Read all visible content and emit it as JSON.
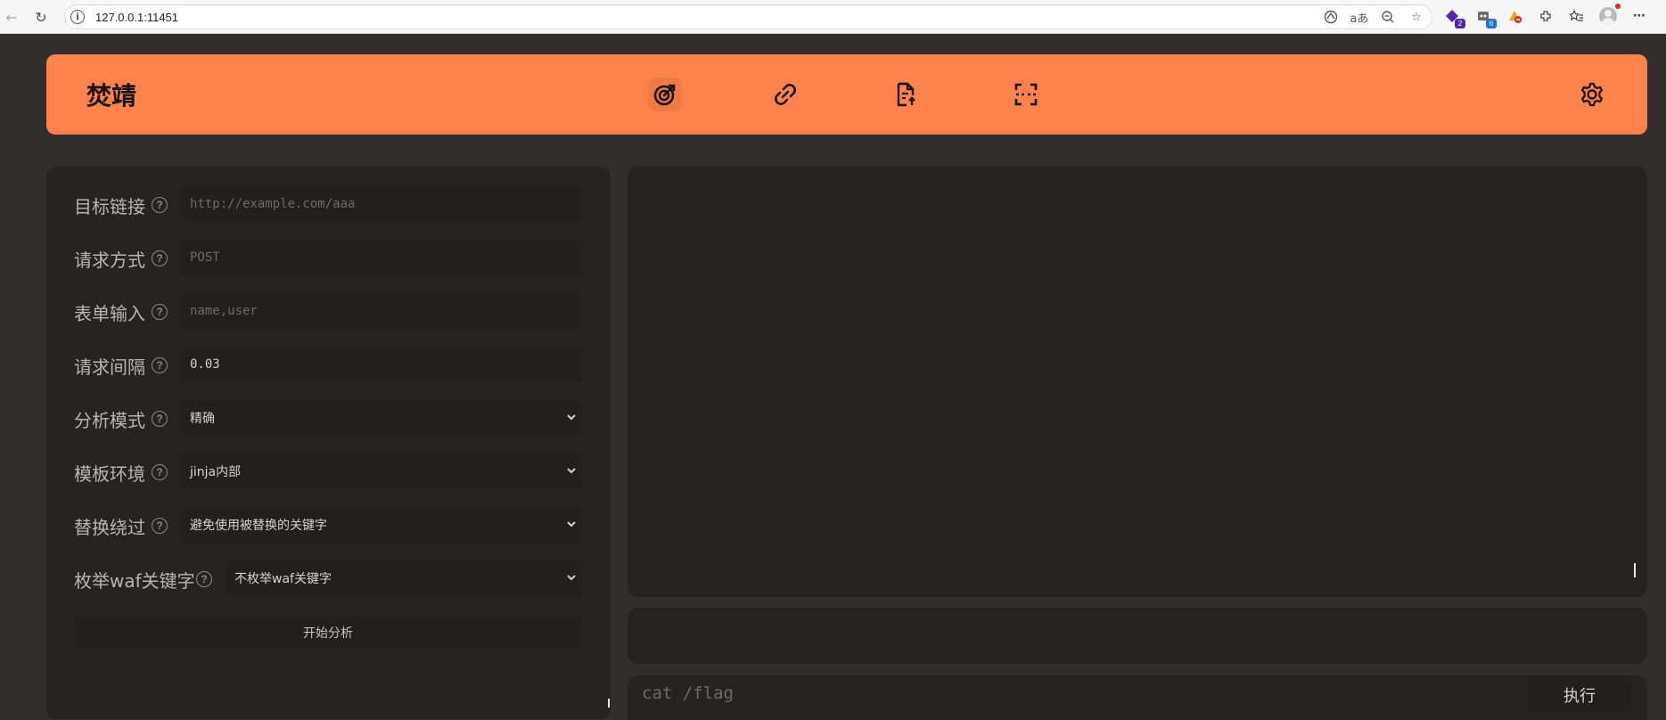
{
  "browser": {
    "url": "127.0.0.1:11451",
    "extension_badges": [
      "2",
      "6"
    ],
    "icons": [
      "back-icon",
      "reload-icon",
      "info-icon",
      "copilot-icon",
      "read-aloud-icon",
      "zoom-out-icon",
      "favorite-star-icon",
      "extension-icon",
      "favorites-icon",
      "profile-icon",
      "more-icon"
    ]
  },
  "app": {
    "brand": "焚靖",
    "nav_icons": [
      "crack-target-icon",
      "link-icon",
      "file-upload-icon",
      "scan-icon",
      "settings-icon"
    ],
    "accent_color": "#fd834c"
  },
  "form": {
    "target_url": {
      "label": "目标链接",
      "placeholder": "http://example.com/aaa",
      "value": ""
    },
    "method": {
      "label": "请求方式",
      "placeholder": "POST",
      "value": ""
    },
    "inputs": {
      "label": "表单输入",
      "placeholder": "name,user",
      "value": ""
    },
    "interval": {
      "label": "请求间隔",
      "value": "0.03"
    },
    "detect_mode": {
      "label": "分析模式",
      "selected": "精确"
    },
    "environment": {
      "label": "模板环境",
      "selected": "jinja内部"
    },
    "replace_bypass": {
      "label": "替换绕过",
      "selected": "避免使用被替换的关键字"
    },
    "waf_keywords": {
      "label": "枚举waf关键字",
      "selected": "不枚举waf关键字"
    },
    "help_glyph": "?",
    "start_button": "开始分析"
  },
  "command": {
    "placeholder": "cat /flag",
    "exec_button": "执行"
  }
}
